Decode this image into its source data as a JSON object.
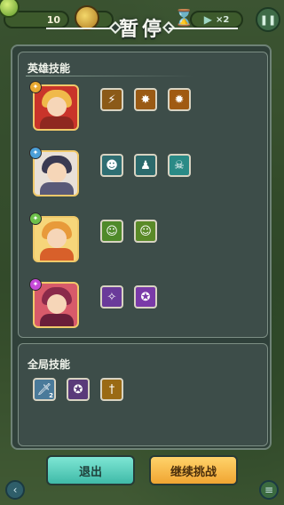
{
  "hud": {
    "coins": "10",
    "speed": "×2",
    "pause_icon": "pause-icon",
    "speed_icon": "play-icon"
  },
  "title": "暂停",
  "hero_section": {
    "title": "英雄技能",
    "heroes": [
      {
        "name": "hero-1",
        "badge_color": "#e8a830",
        "portrait_colors": [
          "#c9342a",
          "#f0b94a"
        ],
        "skills": [
          {
            "icon": "lightning-icon",
            "bg": "#8b5a18"
          },
          {
            "icon": "arrow-burst-icon",
            "bg": "#9a5a14"
          },
          {
            "icon": "flame-icon",
            "bg": "#a05a12"
          }
        ]
      },
      {
        "name": "hero-2",
        "badge_color": "#4b9fd8",
        "portrait_colors": [
          "#3a3a52",
          "#e8e0d8"
        ],
        "skills": [
          {
            "icon": "ghost-icon",
            "bg": "#2f6e72"
          },
          {
            "icon": "portrait-icon",
            "bg": "#2c6a6c"
          },
          {
            "icon": "skull-icon",
            "bg": "#2a8a86"
          }
        ]
      },
      {
        "name": "hero-3",
        "badge_color": "#6cc04a",
        "portrait_colors": [
          "#e89a3a",
          "#f6d67a"
        ],
        "skills": [
          {
            "icon": "goblin-icon",
            "bg": "#4f8a2a"
          },
          {
            "icon": "goblin-icon",
            "bg": "#5a8a28"
          }
        ]
      },
      {
        "name": "hero-4",
        "badge_color": "#c64ad8",
        "portrait_colors": [
          "#8a2a4a",
          "#d85a6a"
        ],
        "skills": [
          {
            "icon": "witch-icon",
            "bg": "#6a3a9a"
          },
          {
            "icon": "spirit-icon",
            "bg": "#7a3aa8"
          }
        ]
      }
    ]
  },
  "global_section": {
    "title": "全局技能",
    "skills": [
      {
        "icon": "sword-icon",
        "bg": "#4a7a9a",
        "count": "2"
      },
      {
        "icon": "purple-spirit-icon",
        "bg": "#5a3a7a",
        "count": ""
      },
      {
        "icon": "golden-sword-icon",
        "bg": "#9a6a14",
        "count": ""
      }
    ]
  },
  "buttons": {
    "exit": "退出",
    "continue": "继续挑战"
  },
  "colors": {
    "exit_button": "#52cfbd",
    "continue_button": "#f8bc48",
    "panel_border": "#6e8276"
  }
}
